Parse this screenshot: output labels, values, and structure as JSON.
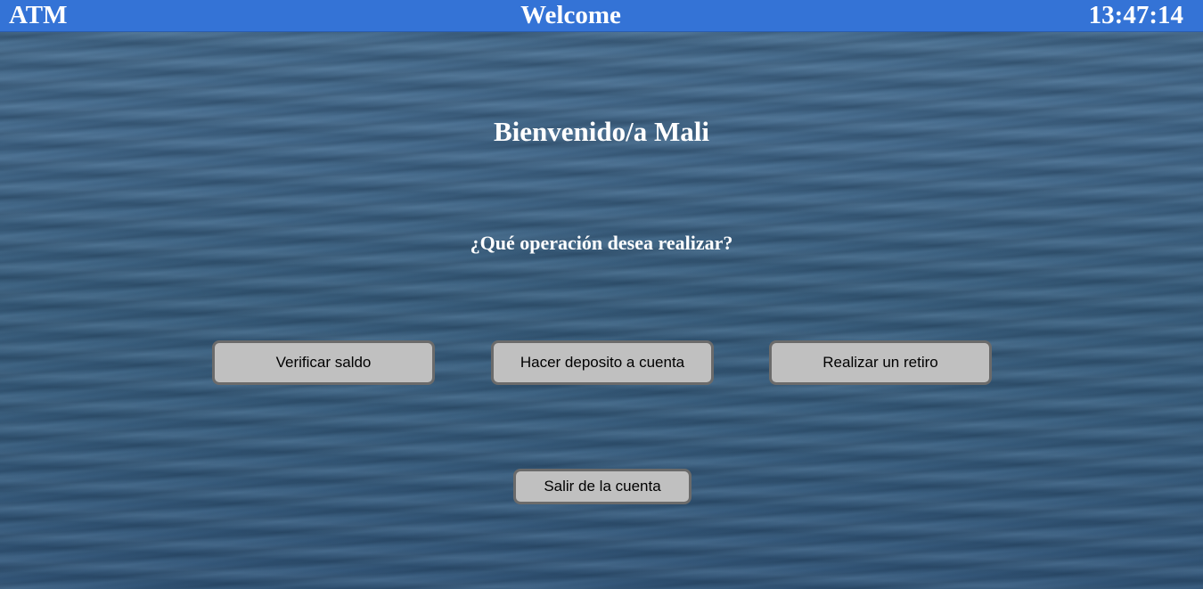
{
  "header": {
    "app_name": "ATM",
    "title": "Welcome",
    "clock": "13:47:14",
    "bar_color": "#3473d6"
  },
  "main": {
    "greeting": "Bienvenido/a Mali",
    "question": "¿Qué operación desea realizar?",
    "operations": [
      {
        "label": "Verificar saldo"
      },
      {
        "label": "Hacer deposito a cuenta"
      },
      {
        "label": "Realizar un retiro"
      }
    ],
    "logout_label": "Salir de la cuenta"
  },
  "colors": {
    "button_bg": "#c0c0c0",
    "button_border": "#6b6b6b",
    "background": "#3c6183"
  }
}
